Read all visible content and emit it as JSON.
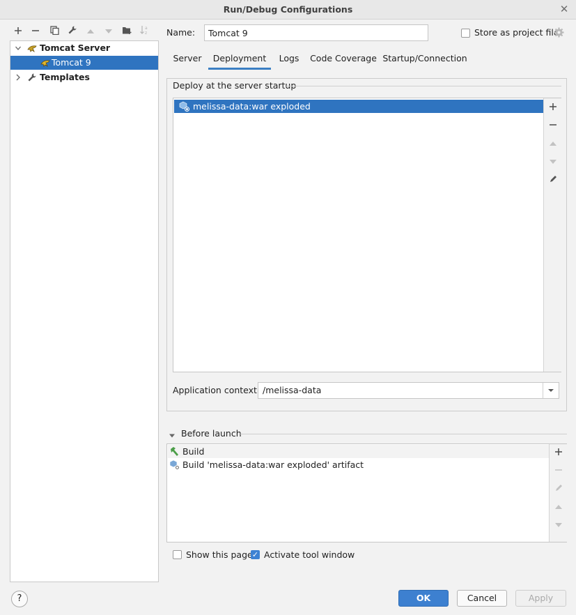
{
  "window": {
    "title": "Run/Debug Configurations"
  },
  "tree": {
    "items": [
      {
        "label": "Tomcat Server"
      },
      {
        "label": "Tomcat 9"
      },
      {
        "label": "Templates"
      }
    ]
  },
  "name_field": {
    "label": "Name:",
    "value": "Tomcat 9"
  },
  "store_project_file": {
    "label": "Store as project file",
    "checked": false
  },
  "tabs": [
    {
      "label": "Server"
    },
    {
      "label": "Deployment"
    },
    {
      "label": "Logs"
    },
    {
      "label": "Code Coverage"
    },
    {
      "label": "Startup/Connection"
    }
  ],
  "active_tab": "Deployment",
  "deployment": {
    "group_title": "Deploy at the server startup",
    "artifacts": [
      {
        "label": "melissa-data:war exploded"
      }
    ],
    "app_context": {
      "label": "Application context:",
      "value": "/melissa-data"
    }
  },
  "before_launch": {
    "title": "Before launch",
    "items": [
      {
        "label": "Build"
      },
      {
        "label": "Build 'melissa-data:war exploded' artifact"
      }
    ]
  },
  "options": {
    "show_page": {
      "label": "Show this page",
      "checked": false
    },
    "activate_tool_window": {
      "label": "Activate tool window",
      "checked": true
    }
  },
  "buttons": {
    "ok": "OK",
    "cancel": "Cancel",
    "apply": "Apply",
    "help": "?"
  },
  "colors": {
    "selection": "#2f74c0",
    "primary_button": "#3d80d0",
    "accent": "#3b7fc4"
  }
}
